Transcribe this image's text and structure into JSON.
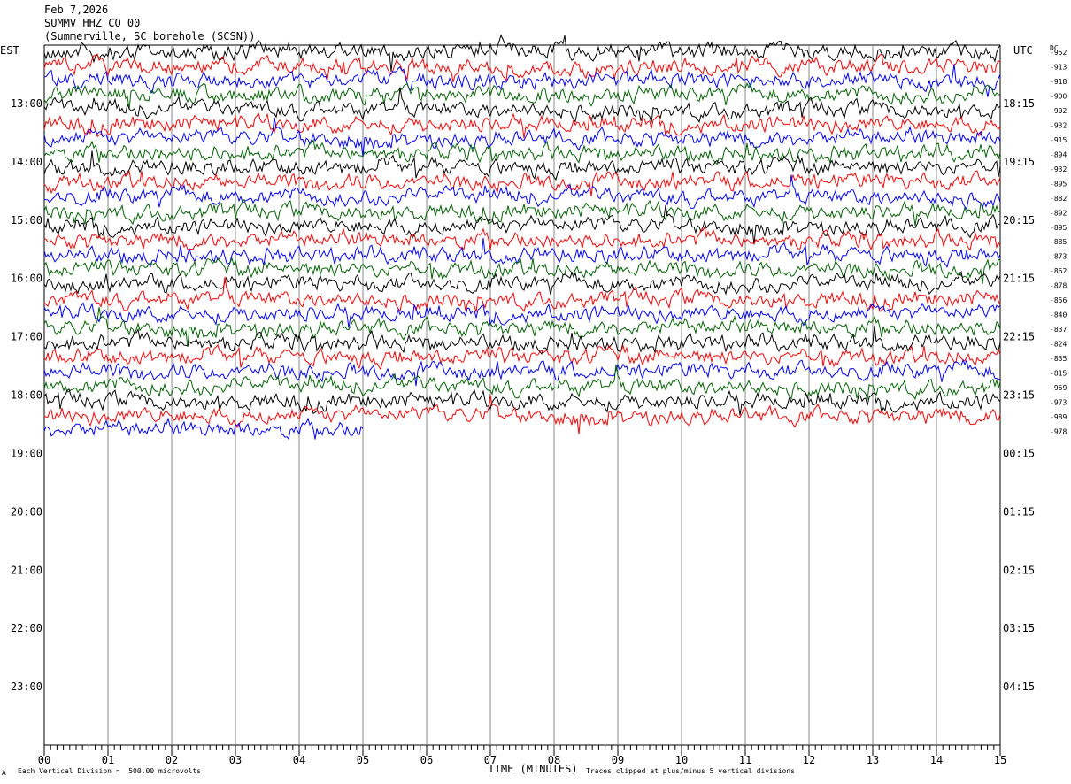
{
  "header": {
    "date": "Feb 7,2026",
    "station": "SUMMV HHZ CO 00",
    "location": "(Summerville, SC borehole (SCSN))"
  },
  "labels": {
    "left_tz": "EST",
    "right_tz": "UTC",
    "dc_label": "DC",
    "xlabel": "TIME (MINUTES)",
    "scale_note": "Each Vertical Division =  500.00 microvolts",
    "clip_note": "Traces clipped at plus/minus 5 vertical divisions",
    "corner_mark": "A"
  },
  "chart_data": {
    "type": "line",
    "title": "SUMMV HHZ CO 00",
    "xlabel": "TIME (MINUTES)",
    "x_ticks": [
      "00",
      "01",
      "02",
      "03",
      "04",
      "05",
      "06",
      "07",
      "08",
      "09",
      "10",
      "11",
      "12",
      "13",
      "14",
      "15"
    ],
    "xlim": [
      0,
      15
    ],
    "left_hours": [
      "13:00",
      "14:00",
      "15:00",
      "16:00",
      "17:00",
      "18:00",
      "19:00",
      "20:00",
      "21:00",
      "22:00",
      "23:00"
    ],
    "right_hours": [
      "18:15",
      "19:15",
      "20:15",
      "21:15",
      "22:15",
      "23:15",
      "00:15",
      "01:15",
      "02:15",
      "03:15",
      "04:15"
    ],
    "trace_colors": [
      "#000000",
      "#ff0000",
      "#0000ff",
      "#006400"
    ],
    "dc_offsets": [
      "-952",
      "-913",
      "-918",
      "-900",
      "-902",
      "-932",
      "-915",
      "-894",
      "-932",
      "-895",
      "-882",
      "-892",
      "-895",
      "-885",
      "-873",
      "-862",
      "-878",
      "-856",
      "-840",
      "-837",
      "-824",
      "-835",
      "-815",
      "-969",
      "-973",
      "-989",
      "-978"
    ],
    "full_traces": 26,
    "last_trace_minutes": 5,
    "traces_per_hour": 4,
    "grid": true
  }
}
